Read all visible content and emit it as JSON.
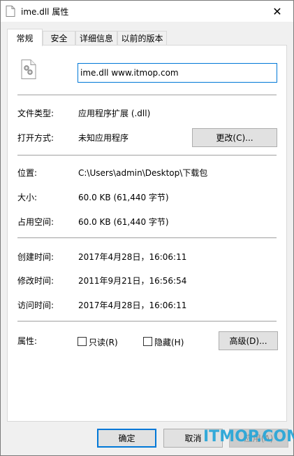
{
  "window": {
    "title": "ime.dll 属性",
    "close_glyph": "✕"
  },
  "tabs": [
    {
      "label": "常规",
      "active": true
    },
    {
      "label": "安全",
      "active": false
    },
    {
      "label": "详细信息",
      "active": false
    },
    {
      "label": "以前的版本",
      "active": false
    }
  ],
  "general": {
    "filename": "ime.dll  www.itmop.com",
    "type_label": "文件类型:",
    "type_value": "应用程序扩展 (.dll)",
    "opens_with_label": "打开方式:",
    "opens_with_value": "未知应用程序",
    "change_button": "更改(C)...",
    "location_label": "位置:",
    "location_value": "C:\\Users\\admin\\Desktop\\下载包",
    "size_label": "大小:",
    "size_value": "60.0 KB (61,440 字节)",
    "size_on_disk_label": "占用空间:",
    "size_on_disk_value": "60.0 KB (61,440 字节)",
    "created_label": "创建时间:",
    "created_value": "2017年4月28日，16:06:11",
    "modified_label": "修改时间:",
    "modified_value": "2011年9月21日，16:56:54",
    "accessed_label": "访问时间:",
    "accessed_value": "2017年4月28日，16:06:11",
    "attributes_label": "属性:",
    "readonly_label": "只读(R)",
    "hidden_label": "隐藏(H)",
    "advanced_button": "高级(D)..."
  },
  "footer": {
    "ok_button": "确定",
    "cancel_button": "取消",
    "apply_button": "应用(A)"
  },
  "watermark": "ITMOP.COM"
}
